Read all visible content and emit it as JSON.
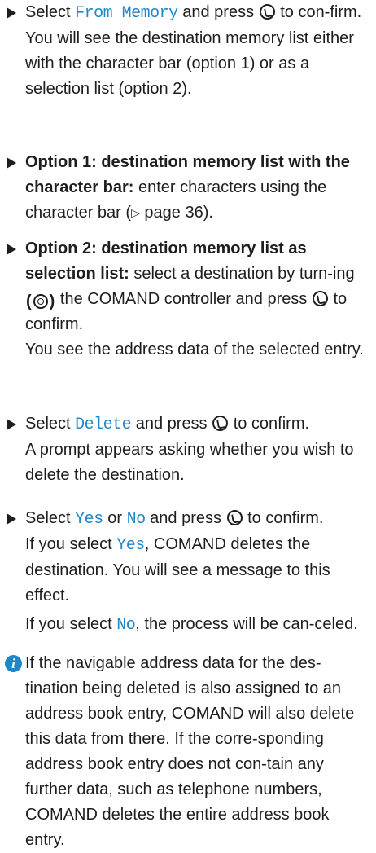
{
  "steps": [
    {
      "p1_pre": "Select ",
      "p1_code": "From Memory",
      "p1_post": " and press",
      "p1_tail": "to con-firm.",
      "p2": "You will see the destination memory list either with the character bar (option 1) or as a selection list (option 2)."
    },
    {
      "bold": "Option 1: destination memory list with the character bar:",
      "text_pre": " enter characters using the character bar (",
      "pageref": "▷",
      "text_post": " page 36)."
    },
    {
      "bold": "Option 2: destination memory list as selection list:",
      "text_pre": " select a destination by turn-ing",
      "text_mid": "the COMAND controller and press",
      "text_post": "to confirm.",
      "p2": "You see the address data of the selected entry."
    },
    {
      "pre": "Select ",
      "code": "Delete",
      "post": " and press",
      "tail": "to confirm.",
      "p2": "A prompt appears asking whether you wish to delete the destination."
    },
    {
      "pre": "Select ",
      "code1": "Yes",
      "mid": " or ",
      "code2": "No",
      "post": " and press",
      "tail": "to confirm.",
      "p2_pre": "If you select ",
      "p2_code": "Yes",
      "p2_post": ", COMAND deletes the destination. You will see a message to this effect.",
      "p3_pre": "If you select ",
      "p3_code": "No",
      "p3_post": ", the process will be can-celed."
    }
  ],
  "note": {
    "icon": "info-icon",
    "text": "If the navigable address data for the des-tination being deleted is also assigned to an address book entry, COMAND will also delete this data from there. If the corre-sponding address book entry does not con-tain any further data, such as telephone numbers, COMAND deletes the entire address book entry."
  }
}
